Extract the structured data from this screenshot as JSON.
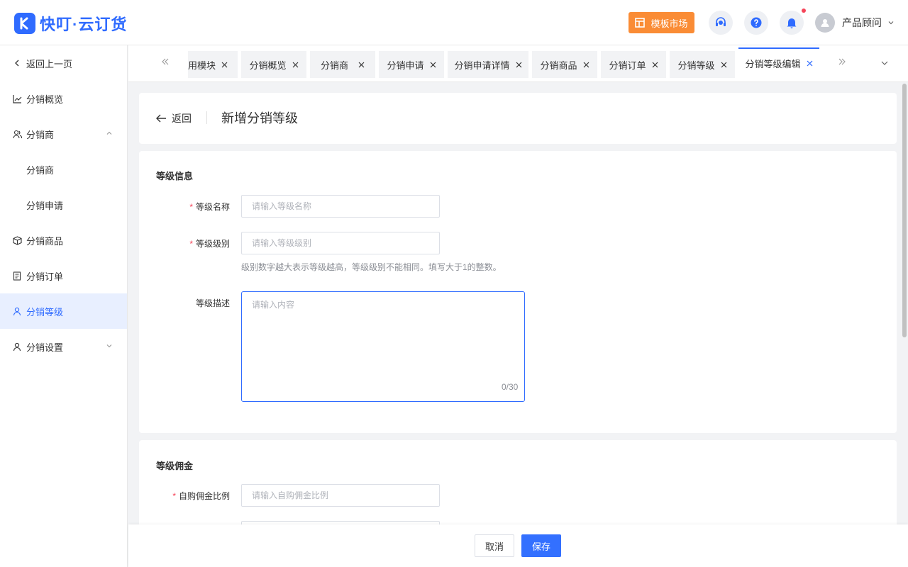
{
  "header": {
    "logo_text": "快叮·云订货",
    "market_label": "模板市场",
    "user_name": "产品顾问"
  },
  "sidebar": {
    "items": [
      {
        "label": "返回上一页"
      },
      {
        "label": "分销概览"
      },
      {
        "label": "分销商"
      },
      {
        "label": "分销商"
      },
      {
        "label": "分销申请"
      },
      {
        "label": "分销商品"
      },
      {
        "label": "分销订单"
      },
      {
        "label": "分销等级"
      },
      {
        "label": "分销设置"
      }
    ]
  },
  "tabs": [
    {
      "label": "用模块"
    },
    {
      "label": "分销概览"
    },
    {
      "label": "分销商"
    },
    {
      "label": "分销申请"
    },
    {
      "label": "分销申请详情"
    },
    {
      "label": "分销商品"
    },
    {
      "label": "分销订单"
    },
    {
      "label": "分销等级"
    },
    {
      "label": "分销等级编辑"
    }
  ],
  "page": {
    "back_label": "返回",
    "title": "新增分销等级"
  },
  "level_info": {
    "section_title": "等级信息",
    "name_label": "等级名称",
    "name_placeholder": "请输入等级名称",
    "level_label": "等级级别",
    "level_placeholder": "请输入等级级别",
    "level_hint": "级别数字越大表示等级越高，等级级别不能相同。填写大于1的整数。",
    "desc_label": "等级描述",
    "desc_placeholder": "请输入内容",
    "desc_counter": "0/30"
  },
  "commission": {
    "section_title": "等级佣金",
    "self_label": "自购佣金比例",
    "self_placeholder": "请输入自购佣金比例"
  },
  "footer": {
    "cancel_label": "取消",
    "save_label": "保存"
  },
  "colors": {
    "primary": "#2f6bff",
    "market": "#fa8c35",
    "required": "#f5455a"
  }
}
